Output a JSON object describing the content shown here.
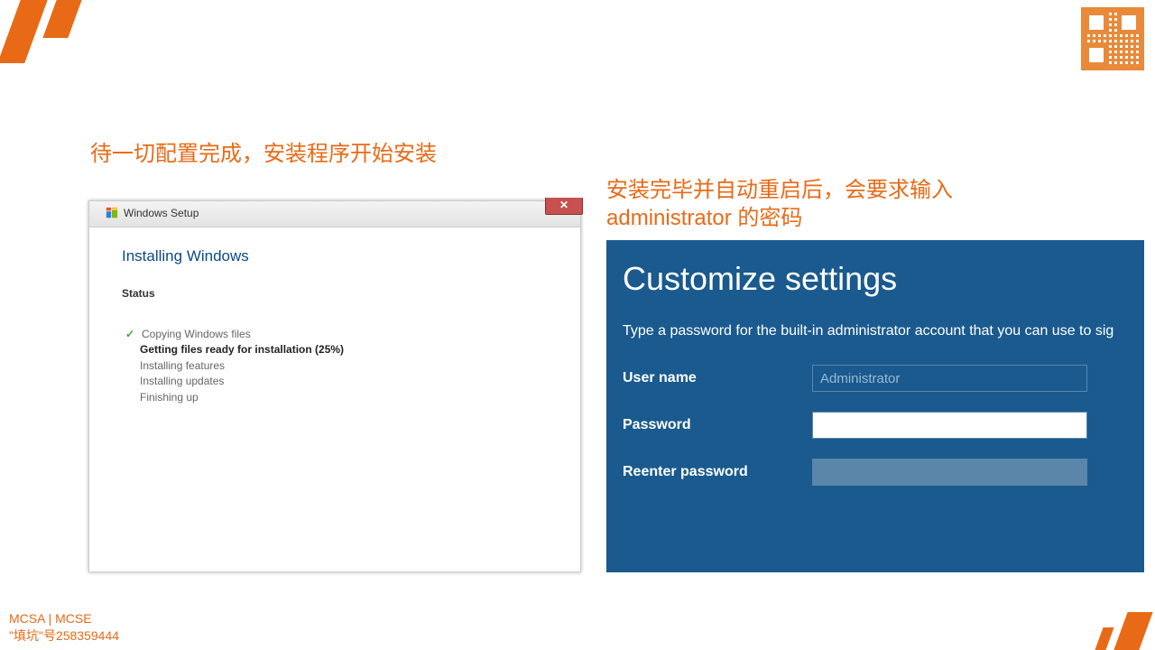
{
  "captions": {
    "left": "待一切配置完成，安装程序开始安装",
    "right_line1": "安装完毕并自动重启后，会要求输入",
    "right_line2": "administrator 的密码"
  },
  "setup_window": {
    "title": "Windows Setup",
    "heading": "Installing Windows",
    "status_label": "Status",
    "steps": {
      "copying": "Copying Windows files",
      "getting_ready": "Getting files ready for installation (25%)",
      "installing_features": "Installing features",
      "installing_updates": "Installing updates",
      "finishing": "Finishing up"
    },
    "close_symbol": "✕"
  },
  "customize": {
    "heading": "Customize settings",
    "description": "Type a password for the built-in administrator account that you can use to sig",
    "username_label": "User name",
    "username_value": "Administrator",
    "password_label": "Password",
    "reenter_label": "Reenter password"
  },
  "footer": {
    "line1": "MCSA | MCSE",
    "line2": "\"填坑\"号258359444"
  }
}
